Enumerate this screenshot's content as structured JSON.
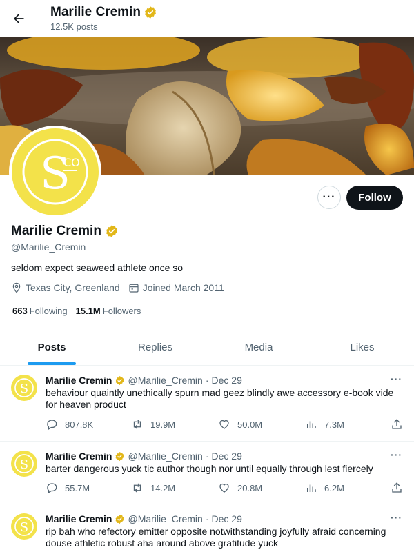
{
  "header": {
    "back_icon": "arrow-left-icon",
    "name": "Marilie Cremin",
    "posts_count": "12.5K posts"
  },
  "profile": {
    "name": "Marilie Cremin",
    "handle": "@Marilie_Cremin",
    "bio": "seldom expect seaweed athlete once so",
    "location": "Texas City, Greenland",
    "joined": "Joined March 2011",
    "following_count": "663",
    "following_label": "Following",
    "followers_count": "15.1M",
    "followers_label": "Followers",
    "follow_label": "Follow",
    "more_label": "···",
    "avatar_text": "S",
    "avatar_sup": "CO"
  },
  "tabs": [
    "Posts",
    "Replies",
    "Media",
    "Likes"
  ],
  "active_tab": "Posts",
  "colors": {
    "accent": "#1d9bf0",
    "verified": "#e2b719",
    "avatar": "#f3e24a"
  },
  "posts": [
    {
      "name": "Marilie Cremin",
      "handle": "@Marilie_Cremin",
      "separator": "·",
      "date": "Dec 29",
      "text": "behaviour quaintly unethically spurn mad geez blindly awe accessory e-book vide for heaven product",
      "replies": "807.8K",
      "reposts": "19.9M",
      "likes": "50.0M",
      "views": "7.3M"
    },
    {
      "name": "Marilie Cremin",
      "handle": "@Marilie_Cremin",
      "separator": "·",
      "date": "Dec 29",
      "text": "barter dangerous yuck tic author though nor until equally through lest fiercely",
      "replies": "55.7M",
      "reposts": "14.2M",
      "likes": "20.8M",
      "views": "6.2M"
    },
    {
      "name": "Marilie Cremin",
      "handle": "@Marilie_Cremin",
      "separator": "·",
      "date": "Dec 29",
      "text": "rip bah who refectory emitter opposite notwithstanding joyfully afraid concerning douse athletic robust aha around above gratitude yuck",
      "replies": "",
      "reposts": "",
      "likes": "",
      "views": ""
    }
  ]
}
